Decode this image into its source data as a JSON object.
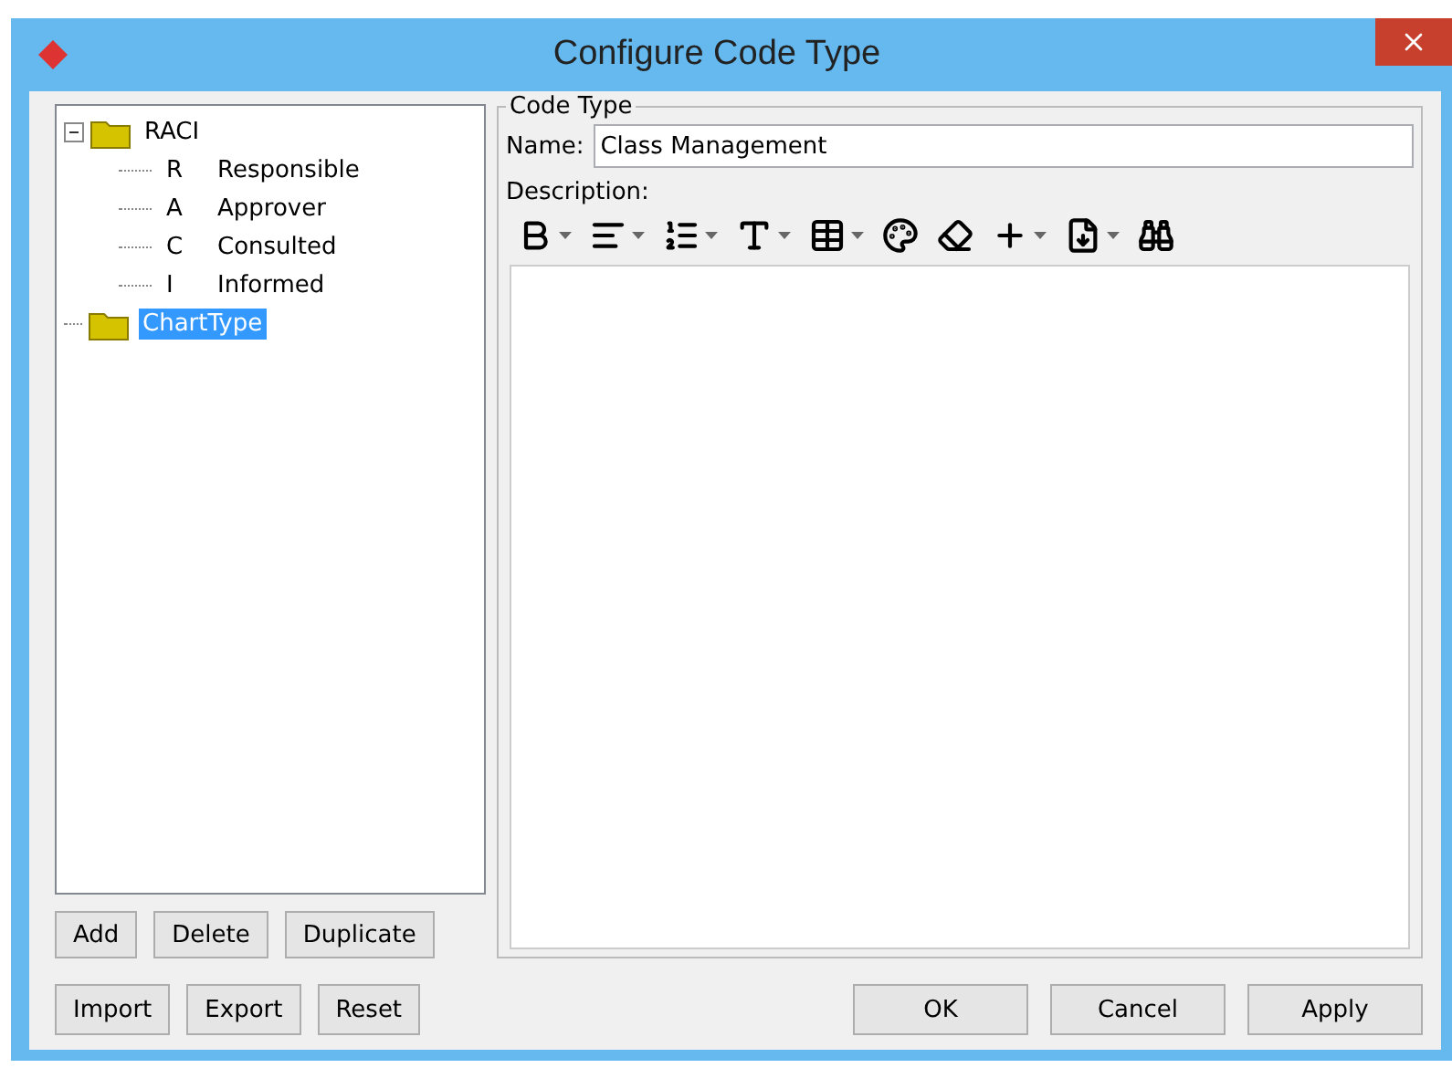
{
  "window": {
    "title": "Configure Code Type"
  },
  "tree": [
    {
      "label": "RACI",
      "expanded": true,
      "selected": false,
      "children": [
        {
          "code": "R",
          "label": "Responsible",
          "selected": false
        },
        {
          "code": "A",
          "label": "Approver",
          "selected": false
        },
        {
          "code": "C",
          "label": "Consulted",
          "selected": false
        },
        {
          "code": "I",
          "label": "Informed",
          "selected": false
        }
      ]
    },
    {
      "label": "ChartType",
      "selected": true
    }
  ],
  "tree_buttons": [
    "Add",
    "Delete",
    "Duplicate"
  ],
  "code_type": {
    "legend": "Code Type",
    "name_label": "Name:",
    "name_value": "Class Management",
    "description_label": "Description:"
  },
  "left_buttons": [
    "Import",
    "Export",
    "Reset"
  ],
  "dialog_buttons": [
    "OK",
    "Cancel",
    "Apply"
  ]
}
